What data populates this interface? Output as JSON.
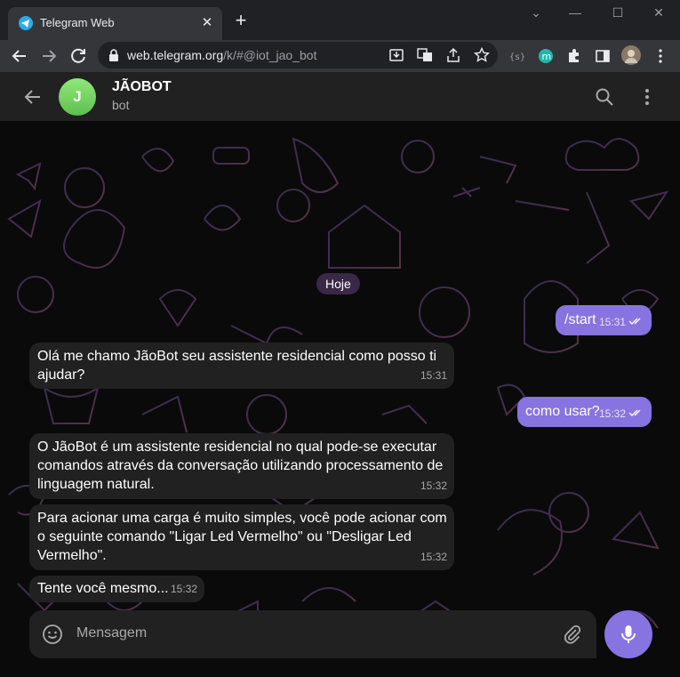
{
  "browser": {
    "tab_title": "Telegram Web",
    "url_host": "web.telegram.org",
    "url_path": "/k/#@iot_jao_bot"
  },
  "chat": {
    "avatar_letter": "J",
    "title": "JÃOBOT",
    "subtitle": "bot"
  },
  "date_separator": "Hoje",
  "messages": [
    {
      "direction": "out",
      "text": "/start",
      "time": "15:31",
      "read": true
    },
    {
      "direction": "in",
      "text": "Olá me chamo JãoBot seu assistente residencial como posso ti ajudar?",
      "time": "15:31"
    },
    {
      "direction": "out",
      "text": "como usar?",
      "time": "15:32",
      "read": true
    },
    {
      "direction": "in",
      "text": "O JãoBot é um assistente residencial no qual pode-se executar comandos através da conversação utilizando processamento de linguagem natural.",
      "time": "15:32"
    },
    {
      "direction": "in",
      "text": "Para acionar uma carga é muito simples, você pode acionar com o seguinte comando \"Ligar Led Vermelho\" ou \"Desligar Led Vermelho\".",
      "time": "15:32"
    },
    {
      "direction": "in",
      "text": "Tente você mesmo...",
      "time": "15:32"
    }
  ],
  "composer": {
    "placeholder": "Mensagem"
  },
  "colors": {
    "outgoing_bubble": "#8774e1",
    "incoming_bubble": "#212121",
    "header_bg": "#212121",
    "accent": "#8774e1"
  }
}
